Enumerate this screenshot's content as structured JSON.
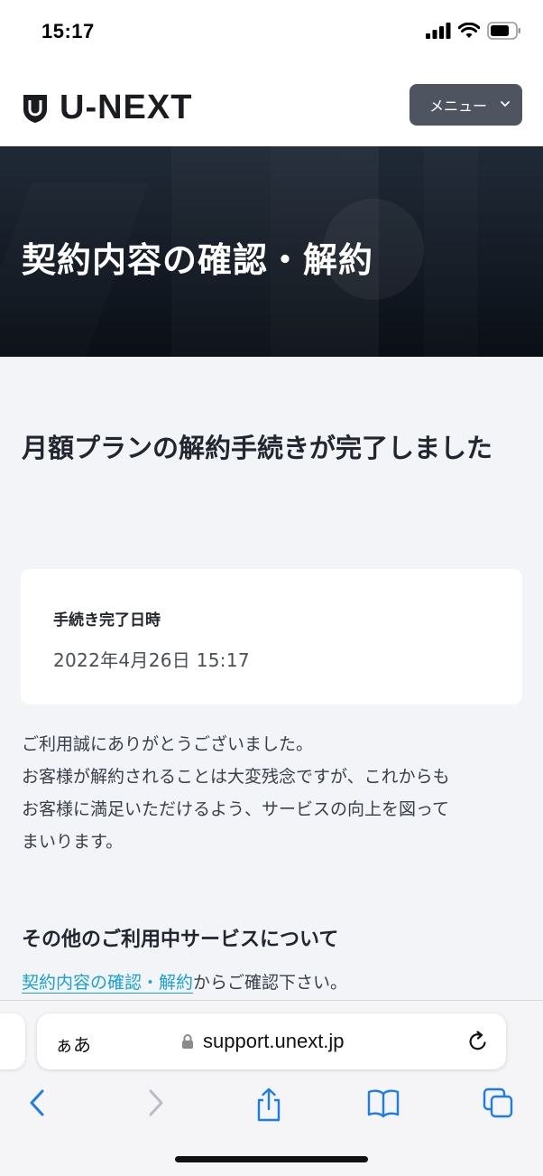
{
  "status_bar": {
    "time": "15:17"
  },
  "header": {
    "logo_text": "U-NEXT",
    "menu_label": "メニュー"
  },
  "hero": {
    "title": "契約内容の確認・解約"
  },
  "main": {
    "heading": "月額プランの解約手続きが完了しました",
    "card": {
      "label": "手続き完了日時",
      "value": "2022年4月26日 15:17"
    },
    "thanks_lines": [
      "ご利用誠にありがとうございました。",
      "お客様が解約されることは大変残念ですが、これからも",
      "お客様に満足いただけるよう、サービスの向上を図って",
      "まいります。"
    ],
    "other": {
      "heading": "その他のご利用中サービスについて",
      "link_text": "契約内容の確認・解約",
      "suffix_text": "からご確認下さい。"
    }
  },
  "browser": {
    "aa_label": "ぁあ",
    "url": "support.unext.jp"
  },
  "icons": {
    "logo": "unext-shield-icon",
    "menu_chevron": "chevron-down-icon",
    "lock": "lock-icon",
    "reload": "reload-icon",
    "back": "back-chevron-icon",
    "forward": "forward-chevron-icon",
    "share": "share-icon",
    "bookmarks": "book-icon",
    "tabs": "tabs-icon"
  },
  "colors": {
    "link": "#1aa0d8",
    "ios_blue": "#1a7cf0",
    "menu_bg": "#4f5560"
  }
}
